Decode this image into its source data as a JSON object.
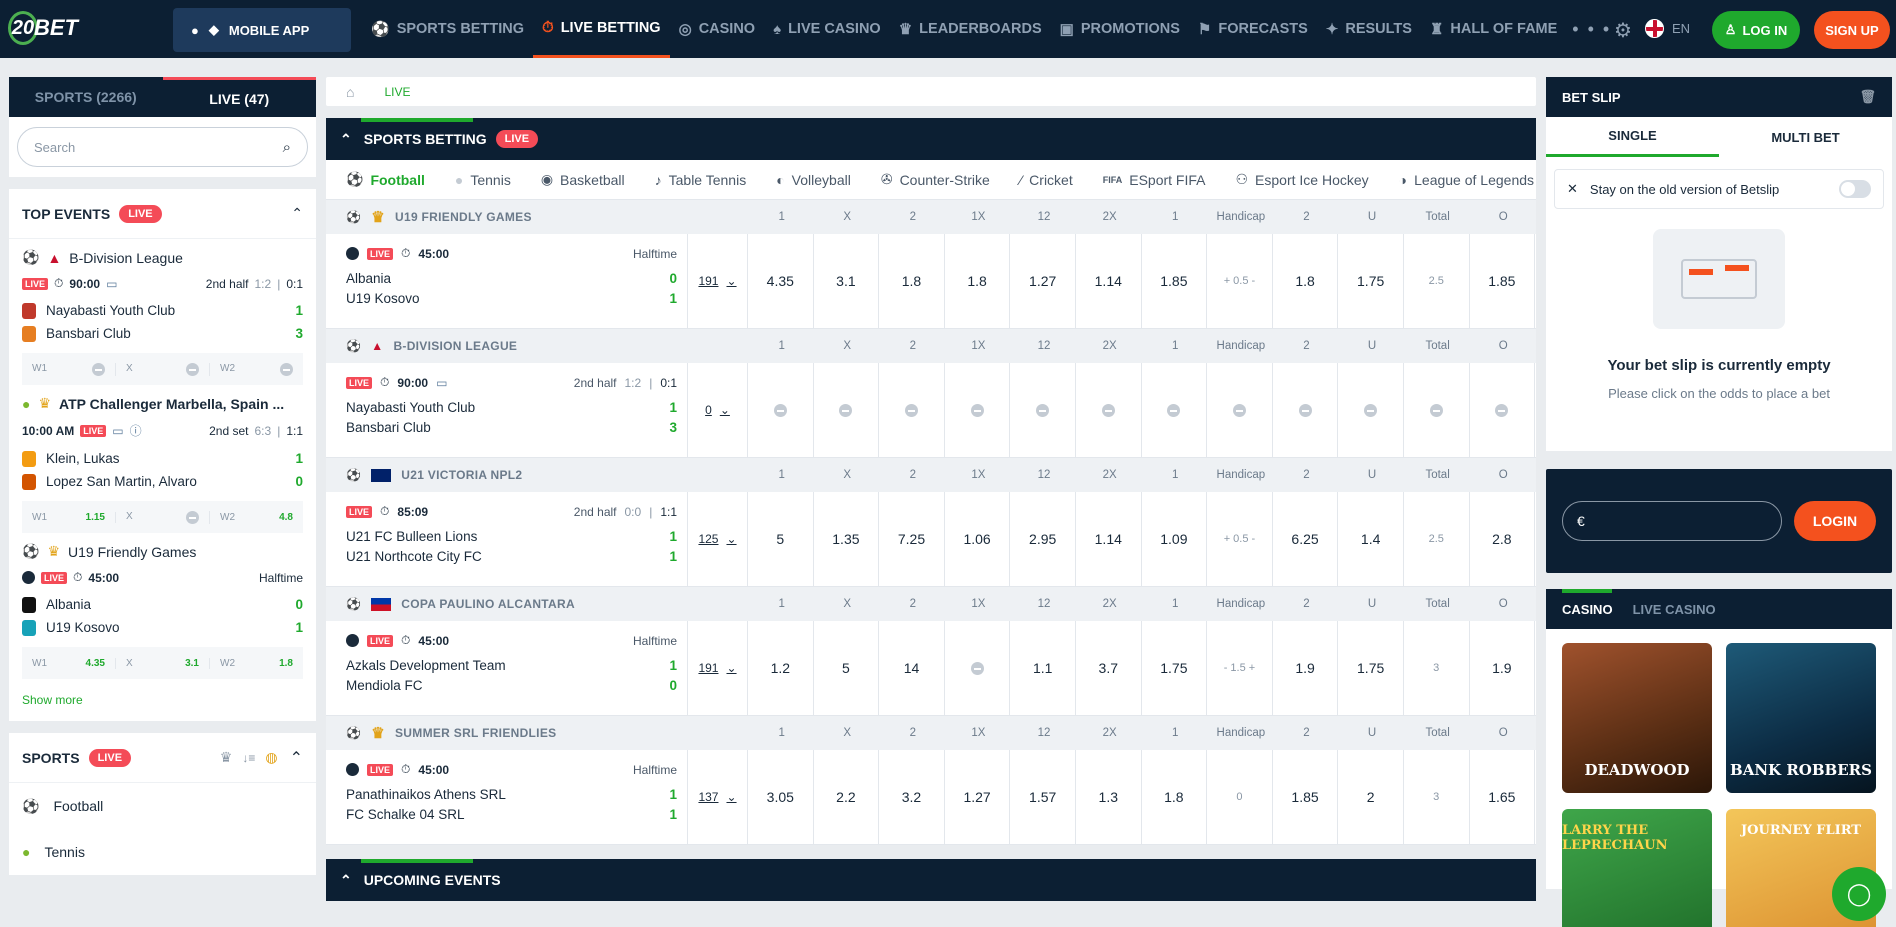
{
  "header": {
    "logo_num": "20",
    "logo_text": "BET",
    "mobile_app": "MOBILE APP",
    "nav": [
      {
        "label": "SPORTS BETTING",
        "icon": "soccer-ball-icon",
        "glyph": "⚽"
      },
      {
        "label": "LIVE BETTING",
        "icon": "stopwatch-icon",
        "glyph": "⏱"
      },
      {
        "label": "CASINO",
        "icon": "roulette-icon",
        "glyph": "◎"
      },
      {
        "label": "LIVE CASINO",
        "icon": "cards-icon",
        "glyph": "♠"
      },
      {
        "label": "LEADERBOARDS",
        "icon": "trophy-icon",
        "glyph": "♛"
      },
      {
        "label": "PROMOTIONS",
        "icon": "gift-icon",
        "glyph": "▣"
      },
      {
        "label": "FORECASTS",
        "icon": "forecast-icon",
        "glyph": "⚑"
      },
      {
        "label": "RESULTS",
        "icon": "results-icon",
        "glyph": "✦"
      },
      {
        "label": "HALL OF FAME",
        "icon": "fame-icon",
        "glyph": "♜"
      }
    ],
    "more": "• • •",
    "lang": "EN",
    "login": "LOG IN",
    "signup": "SIGN UP"
  },
  "left": {
    "tab_sports": "SPORTS (2266)",
    "tab_live": "LIVE (47)",
    "search_placeholder": "Search",
    "top_events_title": "TOP EVENTS",
    "live": "LIVE",
    "live_tag": "LIVE",
    "events": [
      {
        "league": "B-Division League",
        "time": "90:00",
        "state": "2nd half",
        "set": "1:2",
        "score": "0:1",
        "t1": "Nayabasti Youth Club",
        "s1": "1",
        "t2": "Bansbari Club",
        "s2": "3",
        "w1": "W1",
        "x": "X",
        "w2": "W2",
        "o1": "",
        "ox": "",
        "o2": ""
      },
      {
        "league": "ATP Challenger Marbella, Spain ...",
        "time": "10:00 AM",
        "state": "2nd set",
        "set": "6:3",
        "score": "1:1",
        "t1": "Klein, Lukas",
        "s1": "1",
        "t2": "Lopez San Martin, Alvaro",
        "s2": "0",
        "w1": "W1",
        "x": "X",
        "w2": "W2",
        "o1": "1.15",
        "ox": "",
        "o2": "4.8"
      },
      {
        "league": "U19 Friendly Games",
        "time": "45:00",
        "state": "Halftime",
        "t1": "Albania",
        "s1": "0",
        "t2": "U19 Kosovo",
        "s2": "1",
        "w1": "W1",
        "x": "X",
        "w2": "W2",
        "o1": "4.35",
        "ox": "3.1",
        "o2": "1.8"
      }
    ],
    "show_more": "Show more",
    "sports_title": "SPORTS",
    "sports": [
      "Football",
      "Tennis"
    ]
  },
  "center": {
    "breadcrumb": "LIVE",
    "section": "SPORTS BETTING",
    "live": "LIVE",
    "live_tag": "LIVE",
    "sport_tabs": [
      "Football",
      "Tennis",
      "Basketball",
      "Table Tennis",
      "Volleyball",
      "Counter-Strike",
      "Cricket",
      "ESport FIFA",
      "Esport Ice Hockey",
      "League of Legends"
    ],
    "cols": [
      "1",
      "X",
      "2",
      "1X",
      "12",
      "2X",
      "1",
      "Handicap",
      "2",
      "U",
      "Total",
      "O"
    ],
    "leagues": [
      {
        "name": "U19 FRIENDLY GAMES",
        "match": {
          "time": "45:00",
          "state": "Halftime",
          "t1": "Albania",
          "s1": "0",
          "t2": "U19 Kosovo",
          "s2": "1",
          "more": "191",
          "odds": [
            "4.35",
            "3.1",
            "1.8",
            "1.8",
            "1.27",
            "1.14",
            "1.85",
            "+ 0.5 -",
            "1.8",
            "1.75",
            "2.5",
            "1.85"
          ]
        }
      },
      {
        "name": "B-DIVISION LEAGUE",
        "match": {
          "time": "90:00",
          "state": "2nd half",
          "set": "1:2",
          "score": "0:1",
          "t1": "Nayabasti Youth Club",
          "s1": "1",
          "t2": "Bansbari Club",
          "s2": "3",
          "more": "0",
          "odds": [
            "",
            "",
            "",
            "",
            "",
            "",
            "",
            "",
            "",
            "",
            "",
            ""
          ]
        }
      },
      {
        "name": "U21 VICTORIA NPL2",
        "match": {
          "time": "85:09",
          "state": "2nd half",
          "set": "0:0",
          "score": "1:1",
          "t1": "U21 FC Bulleen Lions",
          "s1": "1",
          "t2": "U21 Northcote City FC",
          "s2": "1",
          "more": "125",
          "odds": [
            "5",
            "1.35",
            "7.25",
            "1.06",
            "2.95",
            "1.14",
            "1.09",
            "+ 0.5 -",
            "6.25",
            "1.4",
            "2.5",
            "2.8"
          ]
        }
      },
      {
        "name": "COPA PAULINO ALCANTARA",
        "match": {
          "time": "45:00",
          "state": "Halftime",
          "t1": "Azkals Development Team",
          "s1": "1",
          "t2": "Mendiola FC",
          "s2": "0",
          "more": "191",
          "odds": [
            "1.2",
            "5",
            "14",
            "",
            "1.1",
            "3.7",
            "1.75",
            "- 1.5 +",
            "1.9",
            "1.75",
            "3",
            "1.9"
          ]
        }
      },
      {
        "name": "SUMMER SRL FRIENDLIES",
        "match": {
          "time": "45:00",
          "state": "Halftime",
          "t1": "Panathinaikos Athens SRL",
          "s1": "1",
          "t2": "FC Schalke 04 SRL",
          "s2": "1",
          "more": "137",
          "odds": [
            "3.05",
            "2.2",
            "3.2",
            "1.27",
            "1.57",
            "1.3",
            "1.8",
            "0",
            "1.85",
            "2",
            "3",
            "1.65"
          ]
        }
      }
    ],
    "upcoming": "UPCOMING EVENTS"
  },
  "right": {
    "betslip": "BET SLIP",
    "single": "SINGLE",
    "multi": "MULTI BET",
    "old_version": "Stay on the old version of Betslip",
    "empty_title": "Your bet slip is currently empty",
    "empty_sub": "Please click on the odds to place a bet",
    "currency": "€",
    "login": "LOGIN",
    "casino": "CASINO",
    "live_casino": "LIVE CASINO",
    "games": [
      "DEADWOOD",
      "BANK ROBBERS",
      "LARRY THE LEPRECHAUN",
      "JOURNEY FLIRT"
    ]
  },
  "colors": {
    "brand_green": "#1fa92d",
    "accent_orange": "#f4511e",
    "navy": "#0c1f33",
    "live_red": "#f44b57"
  }
}
